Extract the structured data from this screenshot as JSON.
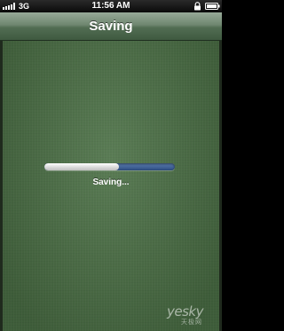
{
  "status_bar": {
    "carrier": "3G",
    "time": "11:56 AM",
    "icons": [
      "signal-icon",
      "lock-icon",
      "battery-icon"
    ]
  },
  "nav": {
    "title": "Saving"
  },
  "progress": {
    "label": "Saving...",
    "fraction": 0.57,
    "fill_color": "#ffffff",
    "track_color": "#3a5a8e"
  },
  "watermark": {
    "text": "yesky",
    "subtext": "天极网"
  },
  "colors": {
    "background": "#4c7146",
    "nav_bar": "#526d53"
  }
}
